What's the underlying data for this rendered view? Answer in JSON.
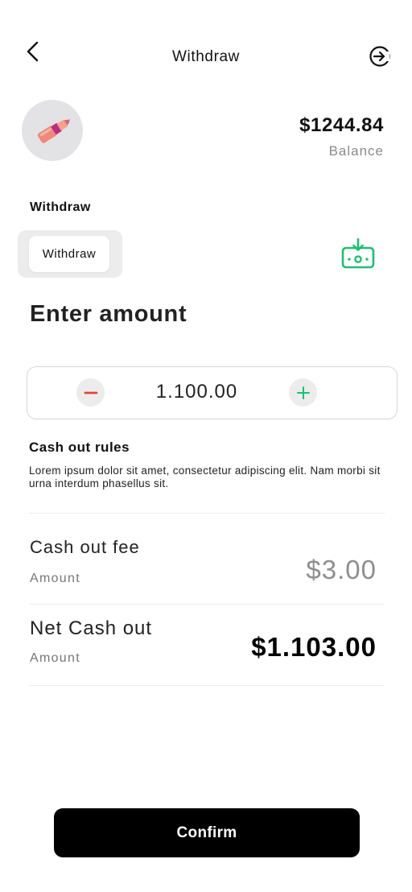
{
  "header": {
    "title": "Withdraw",
    "back_icon": "chevron-left-icon",
    "exit_icon": "sign-in-arrow-icon"
  },
  "profile": {
    "avatar_icon": "lipstick-icon"
  },
  "balance": {
    "amount": "$1244.84",
    "label": "Balance"
  },
  "withdraw": {
    "section_label": "Withdraw",
    "method_label": "Withdraw",
    "method_icon": "cash-withdraw-icon",
    "accent_color": "#1dbf73"
  },
  "amount": {
    "heading": "Enter amount",
    "value": "1.100.00",
    "minus_color": "#e0453a",
    "plus_color": "#1dbf73"
  },
  "rules": {
    "title": "Cash out rules",
    "text": "Lorem ipsum dolor sit amet, consectetur adipiscing elit. Nam morbi sit urna interdum phasellus sit."
  },
  "fee": {
    "title": "Cash out fee",
    "subtitle": "Amount",
    "value": "$3.00"
  },
  "net": {
    "title": "Net Cash out",
    "subtitle": "Amount",
    "value": "$1.103.00"
  },
  "confirm_label": "Confirm"
}
